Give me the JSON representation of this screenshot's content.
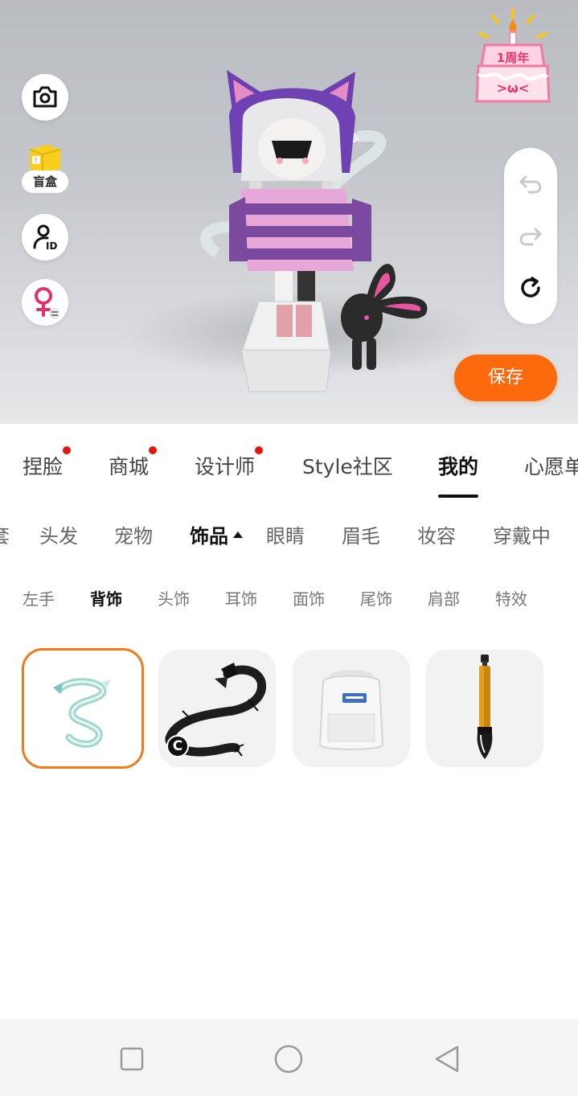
{
  "stage": {
    "blindbox_label": "盲盒",
    "save_label": "保存",
    "anniversary_text": "1周年",
    "anniversary_face": ">ω<"
  },
  "main_tabs": [
    {
      "label": "捏脸",
      "dot": true
    },
    {
      "label": "商城",
      "dot": true
    },
    {
      "label": "设计师",
      "dot": true
    },
    {
      "label": "Style社区",
      "dot": false
    },
    {
      "label": "我的",
      "dot": false,
      "active": true
    },
    {
      "label": "心愿单",
      "dot": false
    }
  ],
  "sub_tabs": [
    {
      "label": "套"
    },
    {
      "label": "头发"
    },
    {
      "label": "宠物"
    },
    {
      "label": "饰品",
      "active": true
    },
    {
      "label": "眼睛"
    },
    {
      "label": "眉毛"
    },
    {
      "label": "妆容"
    },
    {
      "label": "穿戴中"
    }
  ],
  "category_tabs": [
    {
      "label": "左手"
    },
    {
      "label": "背饰",
      "active": true
    },
    {
      "label": "头饰"
    },
    {
      "label": "耳饰"
    },
    {
      "label": "面饰"
    },
    {
      "label": "尾饰"
    },
    {
      "label": "肩部"
    },
    {
      "label": "特效"
    }
  ],
  "items": [
    {
      "icon": "teal-dragon-icon",
      "selected": true
    },
    {
      "icon": "black-dragon-icon",
      "badge": "C"
    },
    {
      "icon": "white-backpack-icon"
    },
    {
      "icon": "calligraphy-brush-icon"
    }
  ],
  "colors": {
    "accent": "#fd6a0d",
    "selected_border": "#f2791c",
    "badge_dot": "#e3150d"
  }
}
